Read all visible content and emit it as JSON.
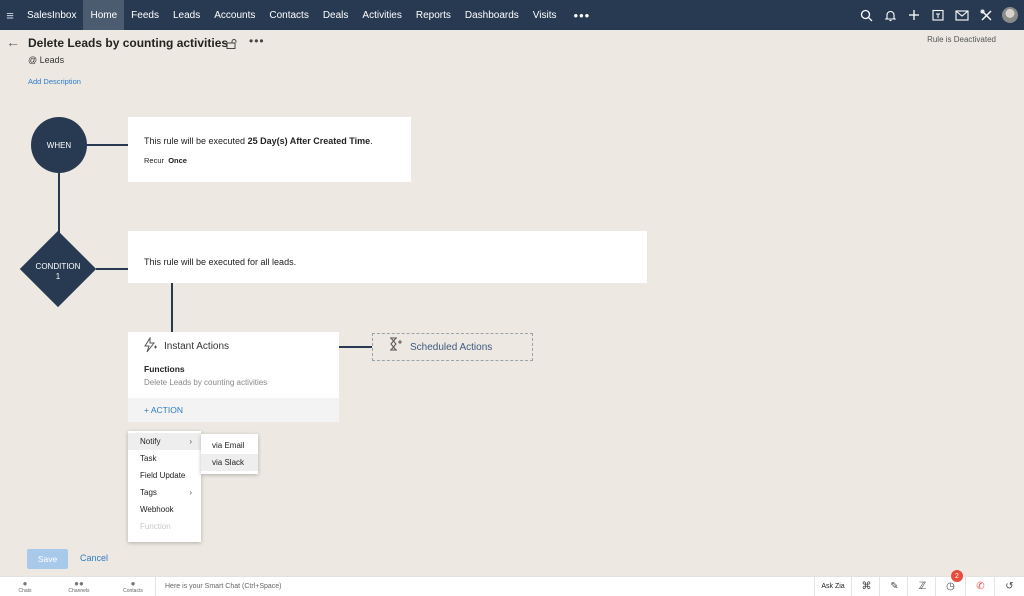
{
  "nav": {
    "brand": "SalesInbox",
    "items": [
      "Home",
      "Feeds",
      "Leads",
      "Accounts",
      "Contacts",
      "Deals",
      "Activities",
      "Reports",
      "Dashboards",
      "Visits"
    ],
    "active": "Home",
    "more": "•••",
    "icons": [
      "search-icon",
      "bell-icon",
      "plus-icon",
      "calendar-icon",
      "mail-icon",
      "tools-icon",
      "avatar"
    ]
  },
  "header": {
    "title": "Delete Leads by counting activities",
    "module": "@ Leads",
    "add_description": "Add Description",
    "status": "Rule is Deactivated"
  },
  "flow": {
    "when_label": "WHEN",
    "when_text_prefix": "This rule will be executed ",
    "when_text_bold": "25 Day(s) After Created Time",
    "when_text_suffix": ".",
    "recur_label": "Recur",
    "recur_value": "Once",
    "condition_label_1": "CONDITION",
    "condition_label_2": "1",
    "condition_text": "This rule will be executed for all leads.",
    "instant_actions": "Instant Actions",
    "functions_label": "Functions",
    "functions_value": "Delete Leads by counting activities",
    "add_action": "+ ACTION",
    "scheduled_actions": "Scheduled Actions"
  },
  "menu": {
    "items": [
      "Notify",
      "Task",
      "Field Update",
      "Tags",
      "Webhook",
      "Function"
    ],
    "submenu": [
      "via Email",
      "via Slack"
    ]
  },
  "footer": {
    "save": "Save",
    "cancel": "Cancel"
  },
  "bottombar": {
    "chats": "Chats",
    "channels": "Channels",
    "contacts": "Contacts",
    "smart_chat": "Here is your Smart Chat (Ctrl+Space)",
    "ask_zia": "Ask Zia",
    "notification_count": "2"
  },
  "colors": {
    "nav_bg": "#283a52",
    "accent": "#2d7cc7",
    "page_bg": "#ede9e2",
    "badge": "#e74c3c"
  }
}
